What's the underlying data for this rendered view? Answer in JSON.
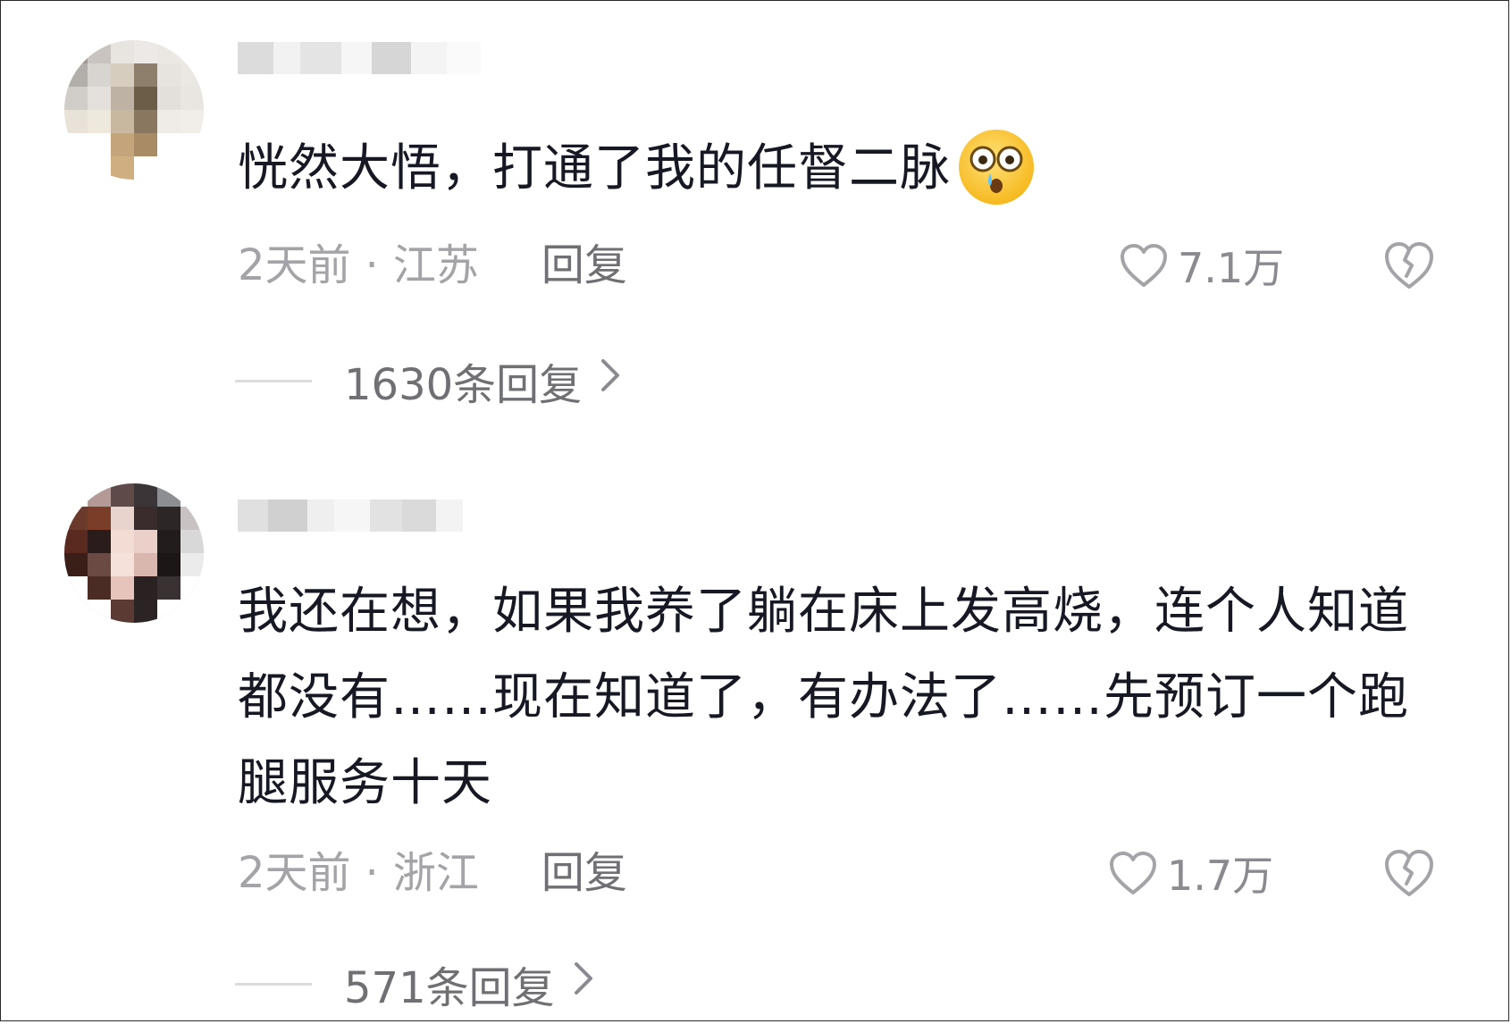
{
  "colors": {
    "text_primary": "#161823",
    "text_meta": "#a3a3a8",
    "text_action": "#6f6f74",
    "divider": "#dcdcdf"
  },
  "comments": [
    {
      "username": "",
      "avatar_icon": "pixelated-avatar",
      "text": "恍然大悟，打通了我的任督二脉",
      "emoji": "crying-surprised-emoji",
      "time": "2天前",
      "separator": "·",
      "location": "江苏",
      "reply_label": "回复",
      "like_icon": "heart-outline-icon",
      "likes": "7.1万",
      "dislike_icon": "broken-heart-icon",
      "replies_label": "1630条回复",
      "chevron_icon": "chevron-right-icon"
    },
    {
      "username": "",
      "avatar_icon": "pixelated-avatar",
      "text": "我还在想，如果我养了躺在床上发高烧，连个人知道都没有……现在知道了，有办法了……先预订一个跑腿服务十天",
      "time": "2天前",
      "separator": "·",
      "location": "浙江",
      "reply_label": "回复",
      "like_icon": "heart-outline-icon",
      "likes": "1.7万",
      "dislike_icon": "broken-heart-icon",
      "replies_label": "571条回复",
      "chevron_icon": "chevron-right-icon"
    }
  ]
}
